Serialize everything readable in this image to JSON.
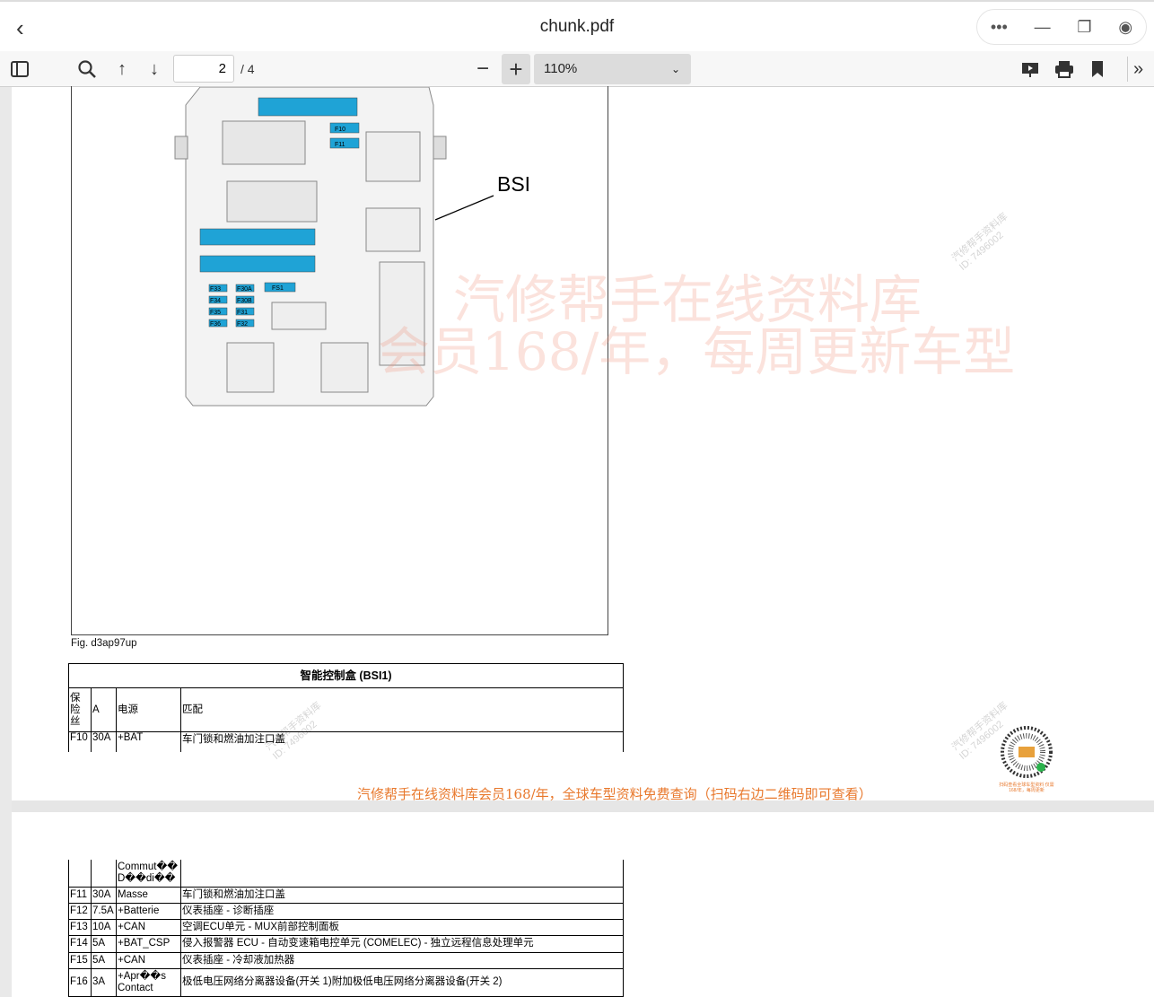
{
  "window": {
    "title": "chunk.pdf",
    "back_icon": "chevron-left-icon"
  },
  "toolbar": {
    "page_current": "2",
    "page_total": "/ 4",
    "zoom": "110%"
  },
  "page1": {
    "callout_label": "BSI",
    "fuse_labels": [
      "F10",
      "F11",
      "FS1",
      "F33",
      "F30A",
      "F34",
      "F30B",
      "F35",
      "F31",
      "F36",
      "F32"
    ],
    "figure_caption": "Fig. d3ap97up",
    "watermark_line1": "汽修帮手在线资料库",
    "watermark_line2": "会员168/年，每周更新车型",
    "watermark_small": "汽修帮手资料库\nID: 7496002",
    "table": {
      "title": "智能控制盒 (BSI1)",
      "headers": [
        "保险丝",
        "A",
        "电源",
        "匹配"
      ],
      "rows": [
        [
          "F10",
          "30A",
          "+BAT",
          "车门锁和燃油加注口盖"
        ]
      ]
    },
    "footer": "汽修帮手在线资料库会员168/年，全球车型资料免费查询（扫码右边二维码即可查看）",
    "qr_caption": "扫码查看全球车型资料 仅需168/年，每周更新"
  },
  "page2": {
    "table": {
      "continued_header": "Commut��D��di��",
      "rows": [
        [
          "F11",
          "30A",
          "Masse",
          "车门锁和燃油加注口盖"
        ],
        [
          "F12",
          "7.5A",
          "+Batterie",
          "仪表插座 - 诊断插座"
        ],
        [
          "F13",
          "10A",
          "+CAN",
          "空调ECU单元 - MUX前部控制面板"
        ],
        [
          "F14",
          "5A",
          "+BAT_CSP",
          "侵入报警器 ECU - 自动变速箱电控单元 (COMELEC) - 独立远程信息处理单元"
        ],
        [
          "F15",
          "5A",
          "+CAN",
          "仪表插座 - 冷却液加热器"
        ],
        [
          "F16",
          "3A",
          "+Apr��s Contact",
          "极低电压网络分离器设备(开关 1)附加极低电压网络分离器设备(开关 2)"
        ]
      ]
    }
  },
  "colors": {
    "fuse_blue": "#1fa3d6",
    "footer_orange": "#e8782c",
    "watermark": "#f09682"
  }
}
